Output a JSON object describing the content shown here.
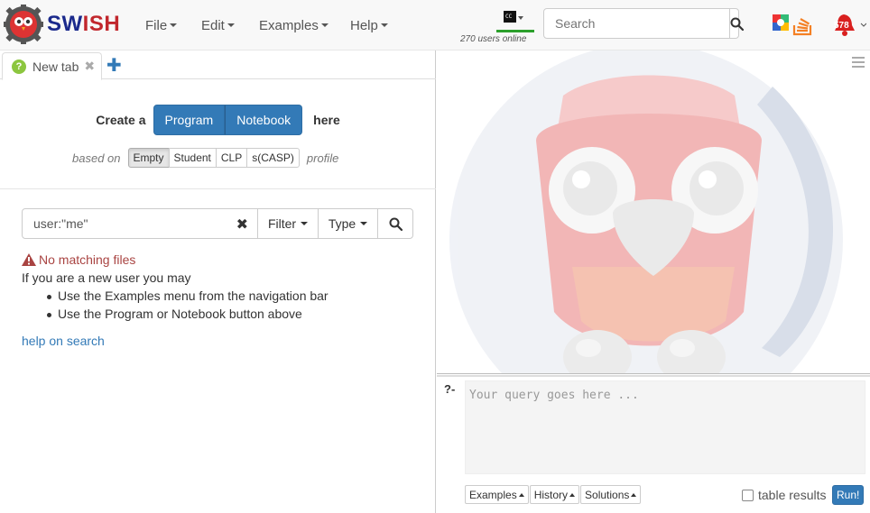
{
  "brand": {
    "sw": "SW",
    "ish": "ISH"
  },
  "menu": [
    {
      "label": "File"
    },
    {
      "label": "Edit"
    },
    {
      "label": "Examples"
    },
    {
      "label": "Help"
    }
  ],
  "online": {
    "text": "270 users online"
  },
  "search": {
    "placeholder": "Search"
  },
  "notifications": {
    "count": "578"
  },
  "tab": {
    "label": "New tab"
  },
  "create": {
    "prefix": "Create a",
    "program": "Program",
    "notebook": "Notebook",
    "suffix": "here"
  },
  "profile": {
    "prefix": "based on",
    "options": [
      "Empty",
      "Student",
      "CLP",
      "s(CASP)"
    ],
    "selected": "Empty",
    "suffix": "profile"
  },
  "filter": {
    "value": "user:\"me\"",
    "filter_label": "Filter",
    "type_label": "Type"
  },
  "results": {
    "warning": "No matching files",
    "intro": "If you are a new user you may",
    "tips": [
      "Use the Examples menu from the navigation bar",
      "Use the Program or Notebook button above"
    ],
    "help_link": "help on search"
  },
  "query": {
    "prompt": "?-",
    "placeholder": "Your query goes here ...",
    "examples": "Examples",
    "history": "History",
    "solutions": "Solutions",
    "table_results": "table results",
    "run": "Run!"
  },
  "colors": {
    "primary": "#337ab7",
    "warning": "#a94442",
    "online_bar": "#2ca02c",
    "brand_blue": "#1b2a8c",
    "brand_red": "#c1272d"
  }
}
